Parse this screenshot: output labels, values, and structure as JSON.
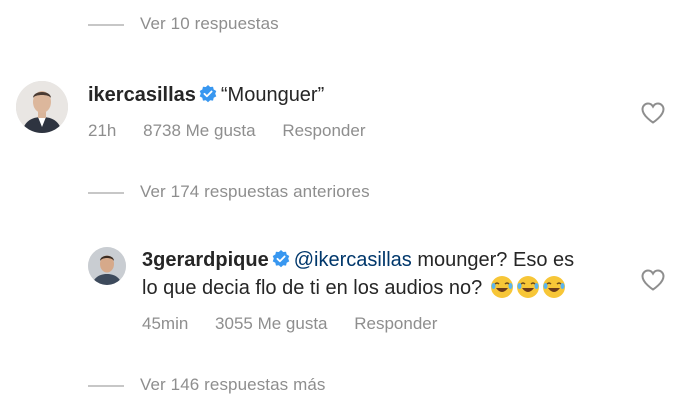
{
  "thread1": {
    "view_more": "Ver 10 respuestas"
  },
  "comment1": {
    "username": "ikercasillas",
    "text": "“Mounguer”",
    "time": "21h",
    "likes": "8738 Me gusta",
    "reply": "Responder",
    "avatar_icon": "avatar-man-suit"
  },
  "thread2": {
    "view_previous": "Ver 174 respuestas anteriores"
  },
  "comment2": {
    "username": "3gerardpique",
    "mention": "@ikercasillas",
    "text_line1": " mounger? Eso es",
    "text_line2": "lo que decia flo de ti en los audios no?",
    "emoji": "face-with-tears-of-joy",
    "time": "45min",
    "likes": "3055 Me gusta",
    "reply": "Responder",
    "avatar_icon": "avatar-man-casual"
  },
  "thread3": {
    "view_more": "Ver 146 respuestas más"
  },
  "colors": {
    "verified": "#3897f0",
    "mention": "#00376b",
    "muted": "#8e8e8e",
    "text": "#262626"
  }
}
